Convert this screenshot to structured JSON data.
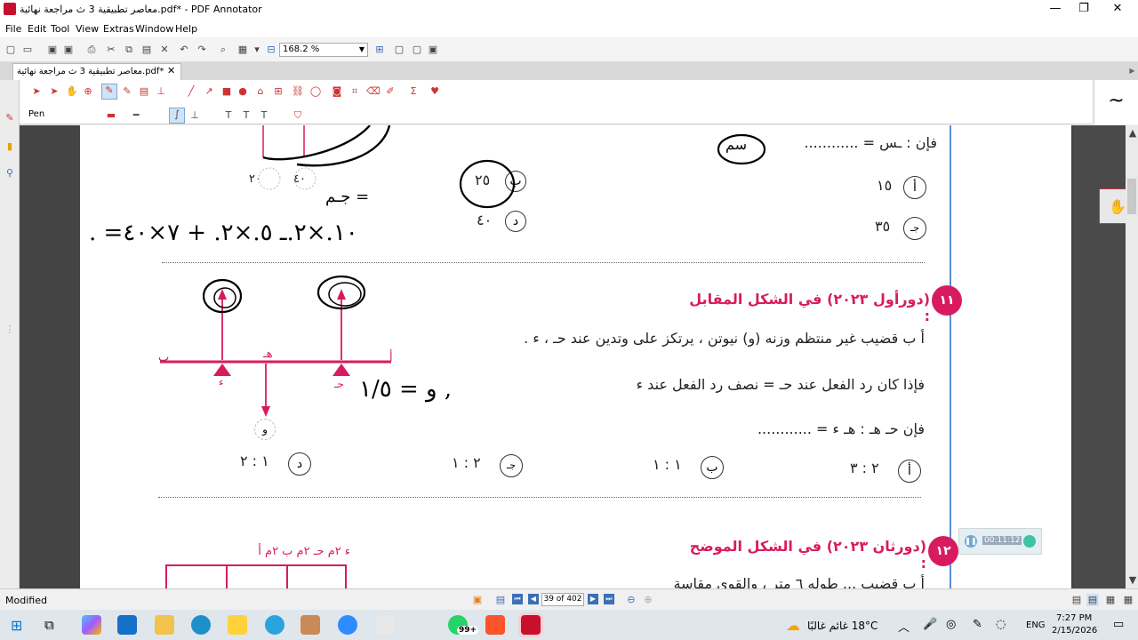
{
  "window": {
    "title": "معاصر تطبيقية 3 ث مراجعة نهائية.pdf* - PDF Annotator",
    "minimize": "—",
    "maximize": "❐",
    "close": "✕"
  },
  "menu": [
    "File",
    "Edit",
    "Tool",
    "View",
    "Extras",
    "Window",
    "Help"
  ],
  "toolbar": {
    "zoom": "168.2 %"
  },
  "tab": {
    "label": "معاصر تطبيقية 3 ث مراجعة نهائية.pdf*",
    "close": "✕"
  },
  "annotation_toolbar": {
    "tool_label": "Pen",
    "pen_preview": "~"
  },
  "page": {
    "top": {
      "labels": [
        "٢٠",
        "٤٠"
      ],
      "formula": "فإن : ـس = ............",
      "ans_b": "٢٥",
      "ans_b_label": "ب",
      "ans_a": "١٥",
      "ans_a_label": "أ",
      "ans_d": "٤٠",
      "ans_d_label": "د",
      "ans_c": "٣٥",
      "ans_c_label": "جـ",
      "hw_equation": ". =١٠.×٢.ـ ٥.×٢. + ٧×٤٠",
      "hw_cm": "سم",
      "hw_jm": "جـم ="
    },
    "q11": {
      "number": "١١",
      "heading": "(دورأول ٢٠٢٣) في الشكل المقابل :",
      "line1": "أ ب قضيب غير منتظم وزنه (و) نيوتن ، يرتكز على وتدين عند حـ ، ء .",
      "line2": "فإذا كان رد الفعل عند حـ = نصف رد الفعل عند ء",
      "line3": "فإن حـ هـ : هـ ء = ............",
      "options": [
        {
          "label": "أ",
          "text": "٢ : ٣"
        },
        {
          "label": "ب",
          "text": "١ : ١"
        },
        {
          "label": "جـ",
          "text": "٢ : ١"
        },
        {
          "label": "د",
          "text": "١ : ٢"
        }
      ],
      "diagram": {
        "a": "أ",
        "b": "ب",
        "h": "هـ",
        "c": "حـ",
        "d": "ء",
        "w": "و"
      },
      "hw_answer": "و = ١/٥ ,"
    },
    "q12": {
      "number": "١٢",
      "heading": "(دورثان ٢٠٢٣) في الشكل الموضح :",
      "labels": "ء ٢م حـ ٢م ب ٢م أ",
      "partial": "أ ب قضيب ... طوله ٦ متر ، والقوى مقاسة"
    }
  },
  "timer": "00:11:12",
  "status": {
    "text": "Modified",
    "page": "39 of 402"
  },
  "taskbar": {
    "weather": "18°C  غائم غالبًا",
    "lang": "ENG",
    "time": "7:27 PM",
    "date": "2/15/2026",
    "badge": "99+"
  },
  "colors": {
    "accent": "#d81b60",
    "brand": "#c8102e",
    "line": "#5b8fd6"
  }
}
